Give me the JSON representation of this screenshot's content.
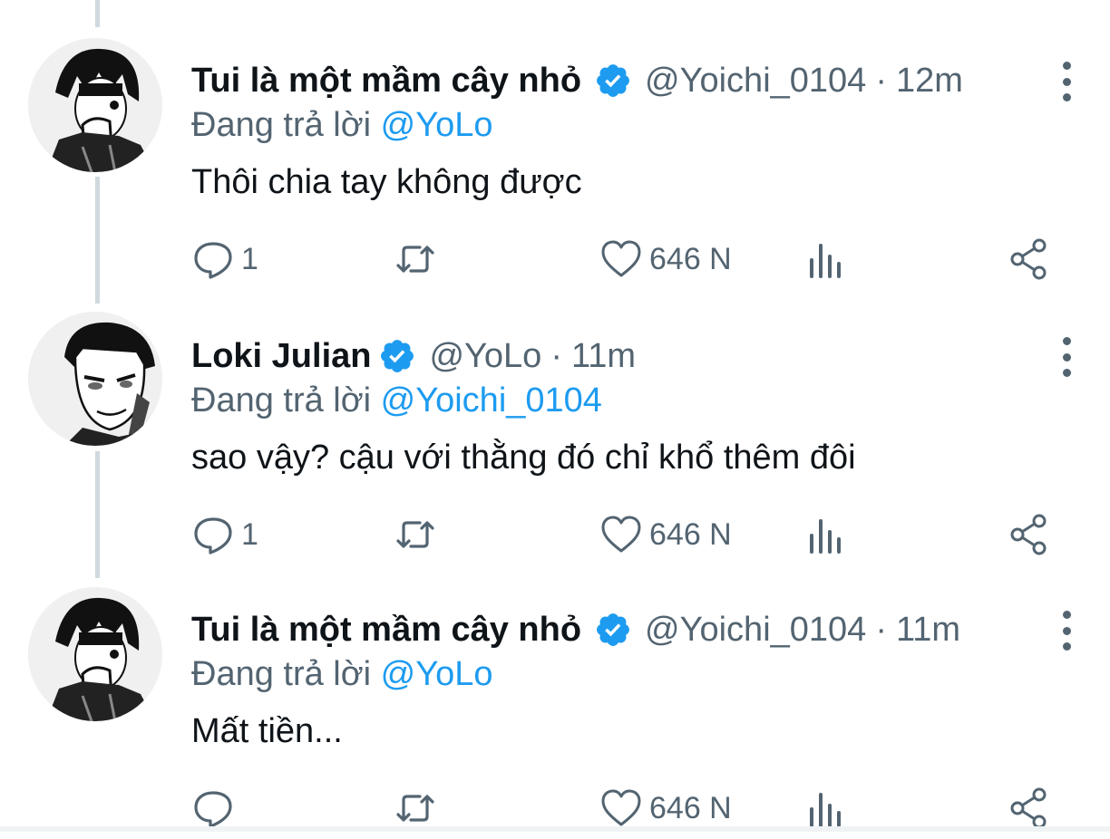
{
  "colors": {
    "accent": "#1d9bf0",
    "muted": "#536471",
    "text": "#0f1419",
    "thread_line": "#cfd9de"
  },
  "icons": {
    "reply": "comment-bubble-icon",
    "retweet": "retweet-icon",
    "like": "heart-icon",
    "views": "bar-chart-icon",
    "share": "share-icon",
    "verified": "verified-badge-icon",
    "more": "more-vertical-icon"
  },
  "tweets": [
    {
      "name": "Tui là một mầm cây nhỏ",
      "handle": "@Yoichi_0104",
      "separator": "·",
      "time": "12m",
      "reply_prefix": "Đang trả lời",
      "reply_to": "@YoLo",
      "text": "Thôi chia tay không được",
      "replies": "1",
      "likes": "646 N"
    },
    {
      "name": "Loki Julian",
      "handle": "@YoLo",
      "separator": "·",
      "time": "11m",
      "reply_prefix": "Đang trả lời",
      "reply_to": "@Yoichi_0104",
      "text": "sao vậy? cậu với thằng đó chỉ khổ thêm đôi",
      "replies": "1",
      "likes": "646 N"
    },
    {
      "name": "Tui là một mầm cây nhỏ",
      "handle": "@Yoichi_0104",
      "separator": "·",
      "time": "11m",
      "reply_prefix": "Đang trả lời",
      "reply_to": "@YoLo",
      "text": "Mất tiền...",
      "replies": "",
      "likes": "646 N"
    }
  ]
}
